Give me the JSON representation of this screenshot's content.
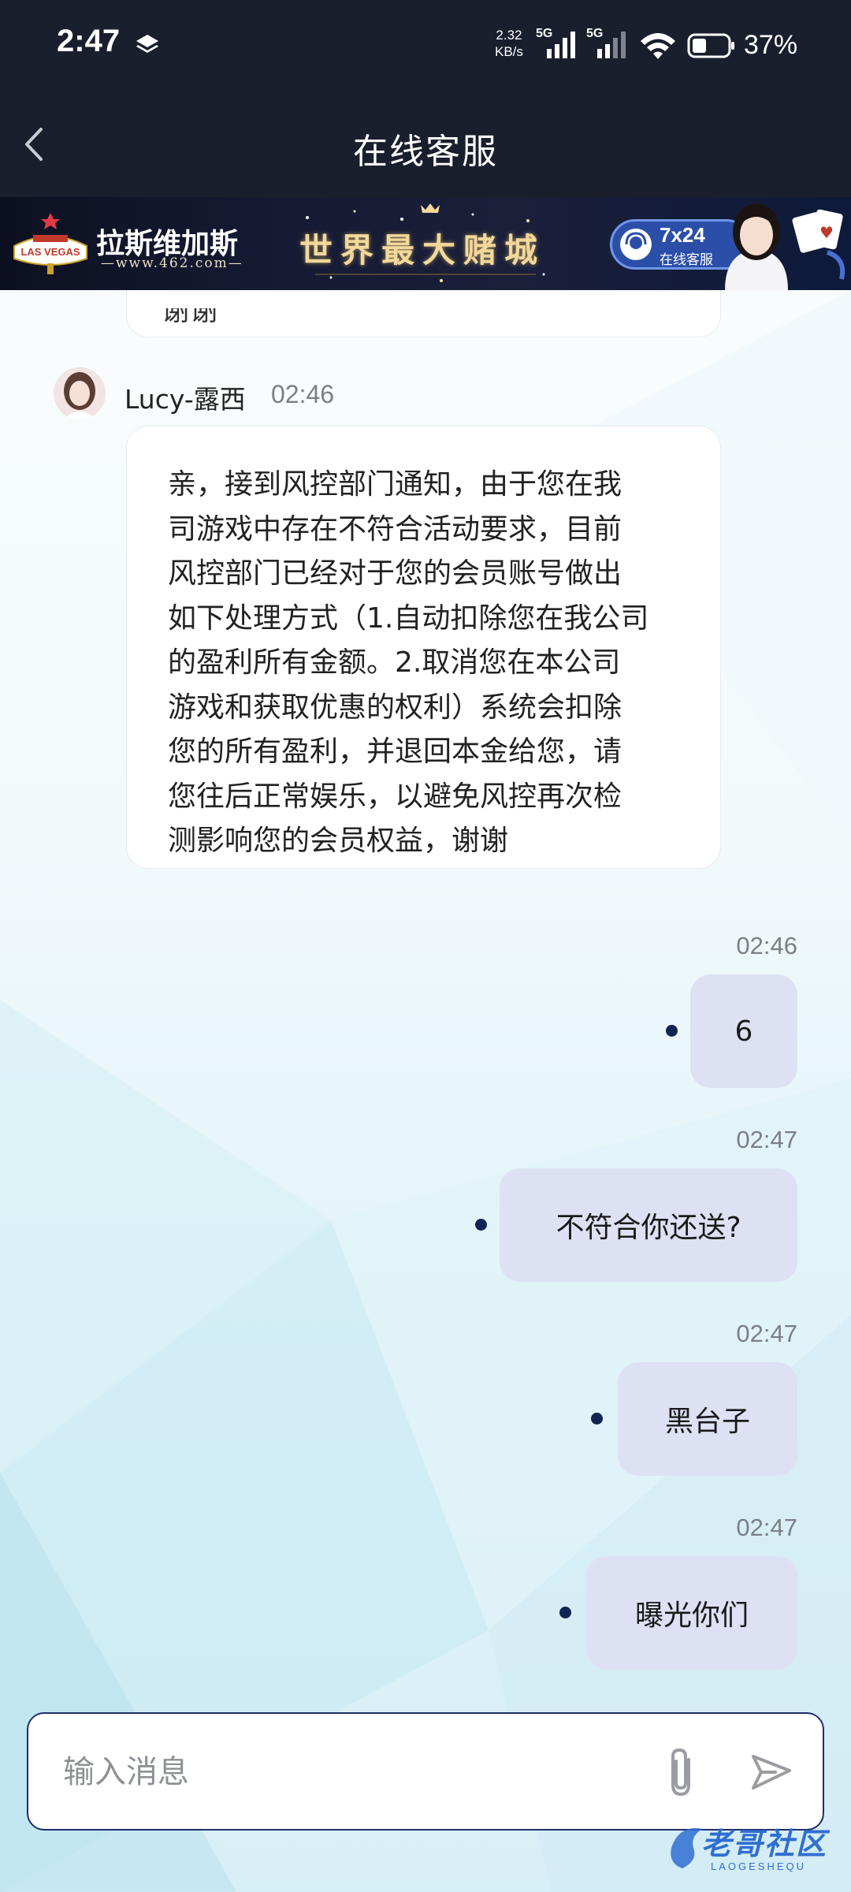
{
  "status_bar": {
    "time": "2:47",
    "net_speed_value": "2.32",
    "net_speed_unit": "KB/s",
    "sim1_label": "5G",
    "sim2_label": "5G",
    "battery": "37%"
  },
  "header": {
    "title": "在线客服"
  },
  "banner": {
    "brand": "拉斯维加斯",
    "url": "—www.462.com—",
    "slogan": "世界最大赌城",
    "service_hours": "7x24",
    "service_label": "在线客服",
    "logo_text": "LAS VEGAS"
  },
  "chat": {
    "previous_tail": "谢谢",
    "agent": {
      "name": "Lucy-露西",
      "time": "02:46",
      "message": "亲，接到风控部门通知，由于您在我\n司游戏中存在不符合活动要求，目前\n风控部门已经对于您的会员账号做出\n如下处理方式（1.自动扣除您在我公司\n的盈利所有金额。2.取消您在本公司\n游戏和获取优惠的权利）系统会扣除\n您的所有盈利，并退回本金给您，请\n您往后正常娱乐，以避免风控再次检\n测影响您的会员权益，谢谢"
    },
    "user_messages": [
      {
        "time": "02:46",
        "text": "6"
      },
      {
        "time": "02:47",
        "text": "不符合你还送?"
      },
      {
        "time": "02:47",
        "text": "黑台子"
      },
      {
        "time": "02:47",
        "text": "曝光你们"
      }
    ]
  },
  "input": {
    "placeholder": "输入消息"
  },
  "watermark": {
    "text": "老哥社区",
    "sub": "LAOGESHEQU"
  },
  "colors": {
    "header_bg": "#1a1f2e",
    "user_bubble": "#dde1f3",
    "sent_dot": "#0f2452",
    "input_border": "#1c2f6b"
  }
}
